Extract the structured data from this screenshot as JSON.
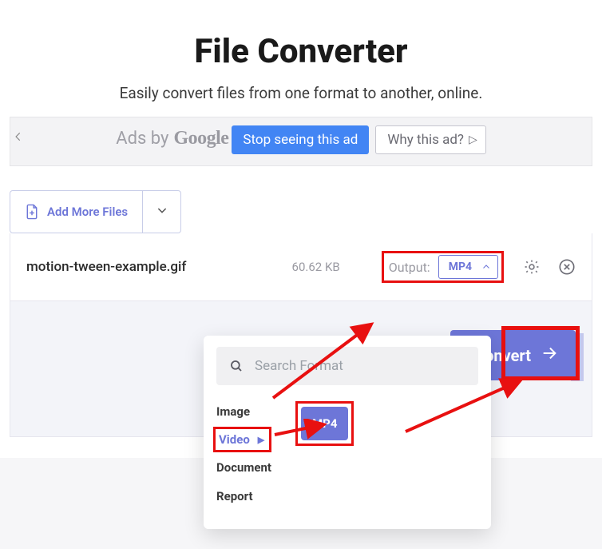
{
  "header": {
    "title": "File Converter",
    "subtitle": "Easily convert files from one format to another, online."
  },
  "ads": {
    "prefix": "Ads by",
    "provider": "Google",
    "stop_label": "Stop seeing this ad",
    "why_label": "Why this ad?"
  },
  "toolbar": {
    "add_more_label": "Add More Files"
  },
  "file": {
    "name": "motion-tween-example.gif",
    "size": "60.62 KB",
    "output_label": "Output:",
    "selected_format": "MP4"
  },
  "convert": {
    "label": "Convert"
  },
  "popover": {
    "search_placeholder": "Search Format",
    "categories": [
      {
        "label": "Image",
        "selected": false
      },
      {
        "label": "Video",
        "selected": true
      },
      {
        "label": "Document",
        "selected": false
      },
      {
        "label": "Report",
        "selected": false
      }
    ],
    "format_option": "MP4"
  },
  "annotation_color": "#e81010"
}
